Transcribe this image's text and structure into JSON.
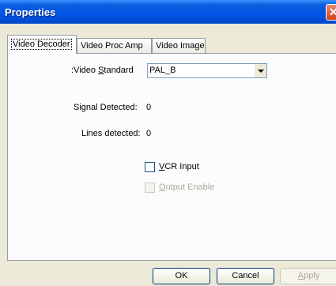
{
  "window": {
    "title": "Properties"
  },
  "tabs": [
    {
      "label": "Video Decoder"
    },
    {
      "label": "Video Proc Amp"
    },
    {
      "label": "Video Image"
    }
  ],
  "decoder": {
    "standard_label_pre": ":Video ",
    "standard_label_mn": "S",
    "standard_label_post": "tandard",
    "standard_value": "PAL_B",
    "signal_label": "Signal Detected:",
    "signal_value": "0",
    "lines_label": "Lines detected:",
    "lines_value": "0",
    "vcr_mn": "V",
    "vcr_rest": "CR Input",
    "output_mn": "O",
    "output_rest": "utput Enable"
  },
  "buttons": {
    "ok": "OK",
    "cancel": "Cancel",
    "apply_mn": "A",
    "apply_rest": "pply"
  }
}
